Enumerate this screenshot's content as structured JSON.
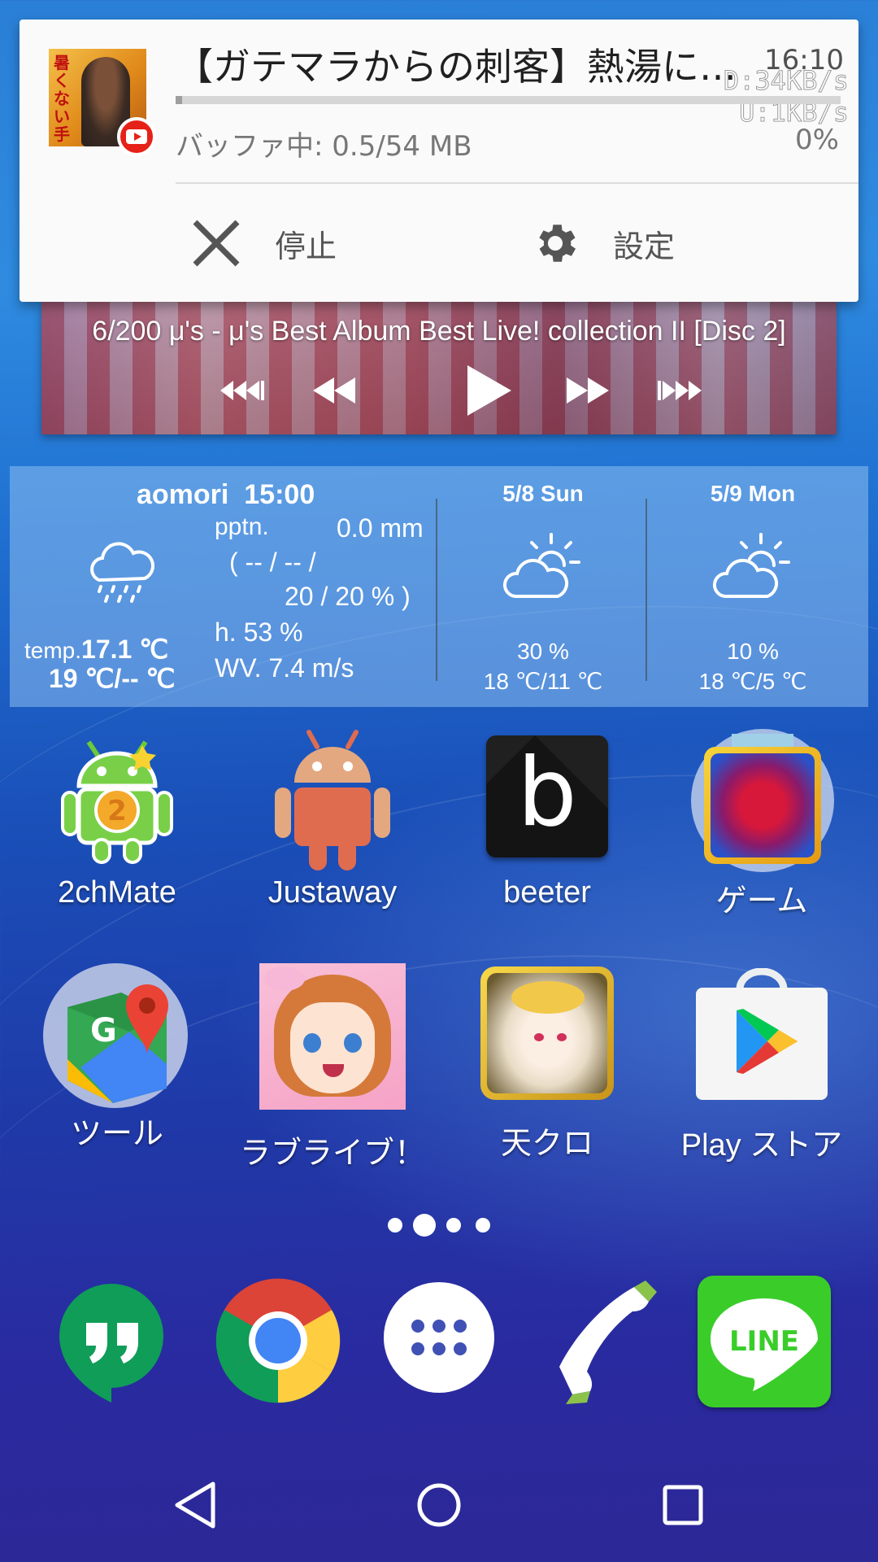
{
  "notification": {
    "title": "【ガテマラからの刺客】熱湯に…",
    "time": "16:10",
    "download_speed": "D:34KB/s",
    "upload_speed": "U:1KB/s",
    "buffer_text": "バッファ中: 0.5/54 MB",
    "percent": "0%",
    "progress_fraction": 0.01,
    "thumbnail_text": "暑くない手",
    "stop_label": "停止",
    "settings_label": "設定"
  },
  "music": {
    "track_info": "6/200  μ's - μ's Best Album Best Live! collection II [Disc 2]"
  },
  "weather": {
    "location": "aomori",
    "time": "15:00",
    "pptn_label": "pptn.",
    "pptn_value": "0.0 mm",
    "pptn_paren": "( -- / -- /",
    "pptn_percent": "20 / 20 % )",
    "temp_label": "temp.",
    "temp_value": "17.1 ℃",
    "temp_range": "19 ℃/-- ℃",
    "humidity": "h.  53 %",
    "wind": "WV.  7.4 m/s",
    "forecast": [
      {
        "date": "5/8 Sun",
        "chance": "30 %",
        "temps": "18 ℃/11 ℃"
      },
      {
        "date": "5/9 Mon",
        "chance": "10 %",
        "temps": "18 ℃/5 ℃"
      }
    ]
  },
  "apps_row1": [
    {
      "label": "2chMate"
    },
    {
      "label": "Justaway"
    },
    {
      "label": "beeter"
    },
    {
      "label": "ゲーム"
    }
  ],
  "apps_row2": [
    {
      "label": "ツール"
    },
    {
      "label": "ラブライブ！"
    },
    {
      "label": "天クロ"
    },
    {
      "label": "Play ストア"
    }
  ],
  "dock": {
    "line_label": "LINE",
    "beeter_letter": "b",
    "mate_number": "2",
    "maps_letter": "G"
  },
  "colors": {
    "youtube_red": "#e62117",
    "line_green": "#3acd2a",
    "hangouts_green": "#0f9d58"
  }
}
